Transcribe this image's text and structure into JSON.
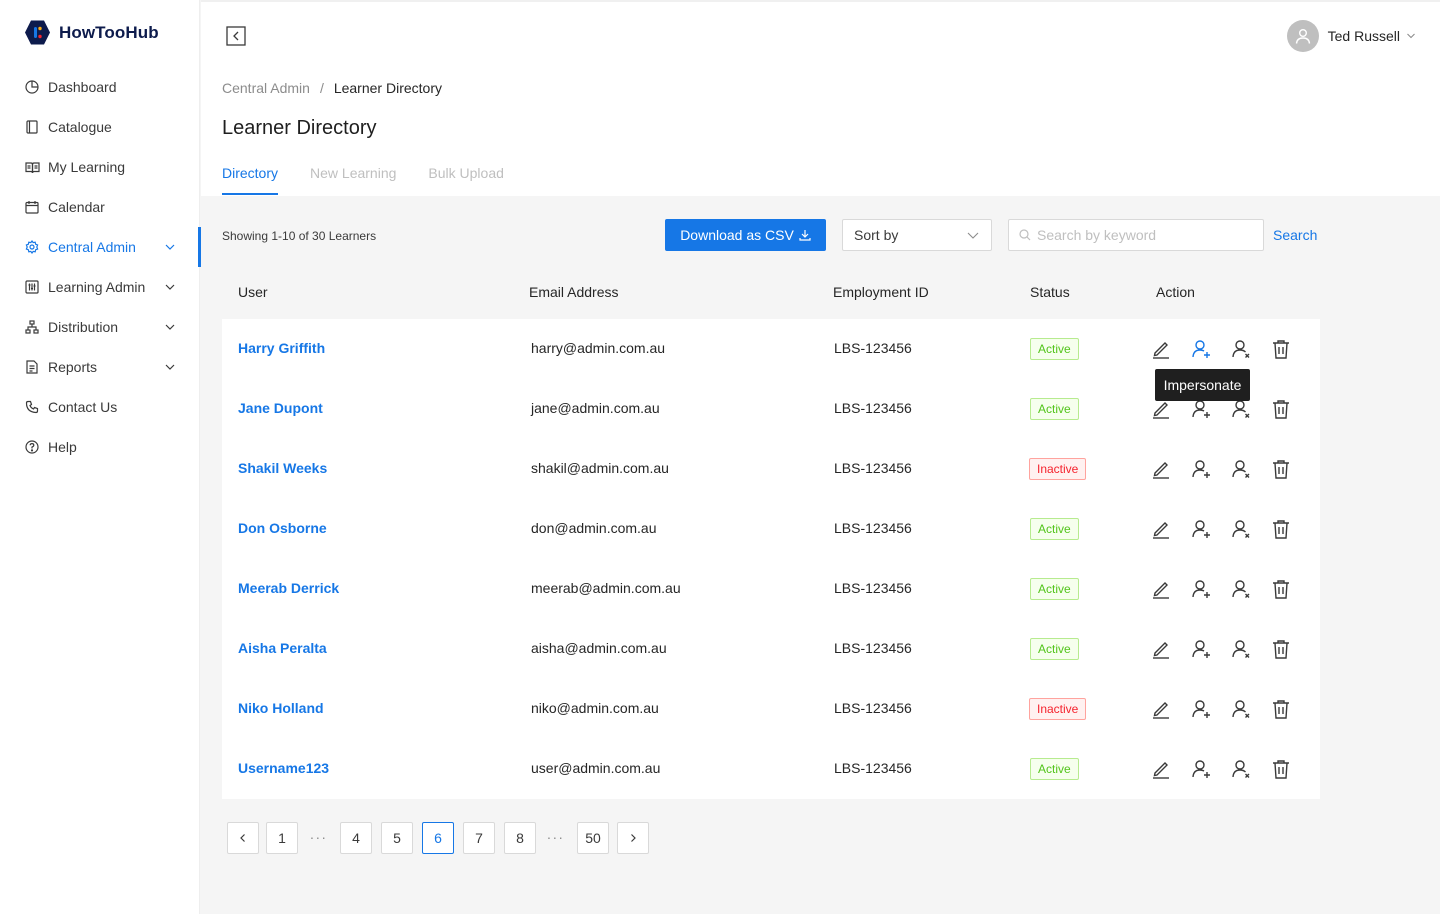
{
  "brand": {
    "name": "HowTooHub"
  },
  "sidebar": {
    "items": [
      {
        "label": "Dashboard",
        "icon": "dashboard-icon"
      },
      {
        "label": "Catalogue",
        "icon": "book-icon"
      },
      {
        "label": "My Learning",
        "icon": "open-book-icon"
      },
      {
        "label": "Calendar",
        "icon": "calendar-icon"
      },
      {
        "label": "Central Admin",
        "icon": "gear-icon",
        "active": true,
        "expandable": true
      },
      {
        "label": "Learning Admin",
        "icon": "sliders-icon",
        "expandable": true
      },
      {
        "label": "Distribution",
        "icon": "hierarchy-icon",
        "expandable": true
      },
      {
        "label": "Reports",
        "icon": "report-icon",
        "expandable": true
      },
      {
        "label": "Contact Us",
        "icon": "phone-icon"
      },
      {
        "label": "Help",
        "icon": "help-icon"
      }
    ]
  },
  "header": {
    "user_name": "Ted Russell"
  },
  "breadcrumb": {
    "parent": "Central Admin",
    "separator": "/",
    "current": "Learner Directory"
  },
  "page": {
    "title": "Learner Directory",
    "tabs": [
      {
        "label": "Directory",
        "active": true
      },
      {
        "label": "New Learning"
      },
      {
        "label": "Bulk Upload"
      }
    ]
  },
  "toolbar": {
    "showing": "Showing 1-10 of 30 Learners",
    "download_label": "Download as CSV",
    "sort_label": "Sort by",
    "search_placeholder": "Search by keyword",
    "search_label": "Search"
  },
  "table": {
    "headers": {
      "user": "User",
      "email": "Email Address",
      "empid": "Employment ID",
      "status": "Status",
      "action": "Action"
    },
    "rows": [
      {
        "user": "Harry Griffith",
        "email": "harry@admin.com.au",
        "empid": "LBS-123456",
        "status": "Active"
      },
      {
        "user": "Jane Dupont",
        "email": "jane@admin.com.au",
        "empid": "LBS-123456",
        "status": "Active"
      },
      {
        "user": "Shakil Weeks",
        "email": "shakil@admin.com.au",
        "empid": "LBS-123456",
        "status": "Inactive"
      },
      {
        "user": "Don Osborne",
        "email": "don@admin.com.au",
        "empid": "LBS-123456",
        "status": "Active"
      },
      {
        "user": "Meerab Derrick",
        "email": "meerab@admin.com.au",
        "empid": "LBS-123456",
        "status": "Active"
      },
      {
        "user": "Aisha Peralta",
        "email": "aisha@admin.com.au",
        "empid": "LBS-123456",
        "status": "Active"
      },
      {
        "user": "Niko Holland",
        "email": "niko@admin.com.au",
        "empid": "LBS-123456",
        "status": "Inactive"
      },
      {
        "user": "Username123",
        "email": "user@admin.com.au",
        "empid": "LBS-123456",
        "status": "Active"
      }
    ]
  },
  "tooltip": {
    "text": "Impersonate"
  },
  "pagination": {
    "pages": [
      "1",
      "...",
      "4",
      "5",
      "6",
      "7",
      "8",
      "...",
      "50"
    ],
    "current": "6"
  },
  "colors": {
    "accent": "#1677e6",
    "active": "#52c41a",
    "inactive": "#f5222d"
  }
}
